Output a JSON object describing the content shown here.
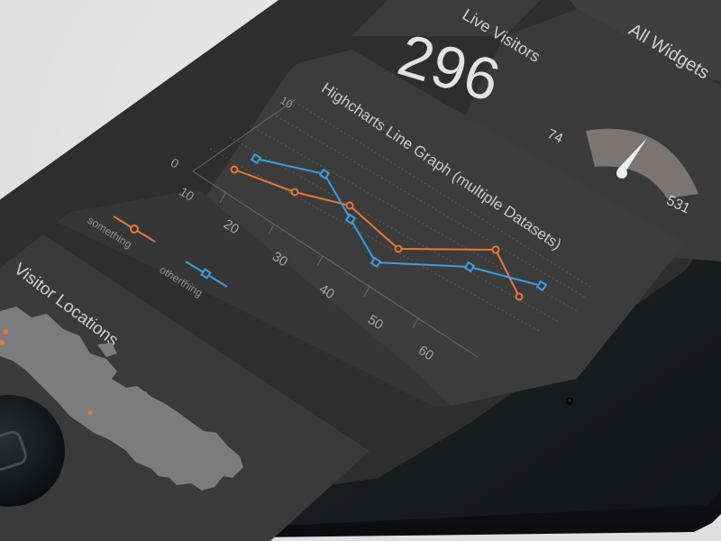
{
  "header": {
    "all_widgets_label": "All Widgets"
  },
  "live_visitors": {
    "title": "Live Visitors",
    "value": "296",
    "gauge": {
      "min_label": "74",
      "max_label": "531",
      "min": 74,
      "max": 531,
      "current": 296
    }
  },
  "line_graph": {
    "title": "Highcharts Line Graph (multiple Datasets)"
  },
  "visitor_locations": {
    "title": "Visitor Locations"
  },
  "chart_data": {
    "type": "line",
    "title": "Highcharts Line Graph (multiple Datasets)",
    "xlabel": "",
    "ylabel": "",
    "x": [
      20,
      30,
      40,
      50,
      60
    ],
    "y_tick_labels": [
      "10",
      "0",
      "10"
    ],
    "series": [
      {
        "name": "something",
        "color": "#e8773a",
        "marker": "circle",
        "points": [
          [
            0.0,
            0.0
          ],
          [
            0.14,
            0.0
          ],
          [
            0.33,
            0.0
          ],
          [
            0.42,
            0.0
          ],
          [
            0.6,
            0.0
          ],
          [
            0.72,
            0.0
          ]
        ]
      },
      {
        "name": "otherthing",
        "color": "#3d9de0",
        "marker": "square",
        "points": [
          [
            0.0,
            0.0
          ],
          [
            0.18,
            0.0
          ],
          [
            0.25,
            0.0
          ],
          [
            0.4,
            0.0
          ],
          [
            0.58,
            0.0
          ],
          [
            0.72,
            0.0
          ]
        ]
      }
    ]
  },
  "colors": {
    "phone_body": "#1c1d20",
    "screen_bg": "#343434",
    "card_bg": "#3c3c3c",
    "text_light": "#c9c9c9",
    "accent_orange": "#e8773a",
    "accent_blue": "#3d9de0"
  }
}
